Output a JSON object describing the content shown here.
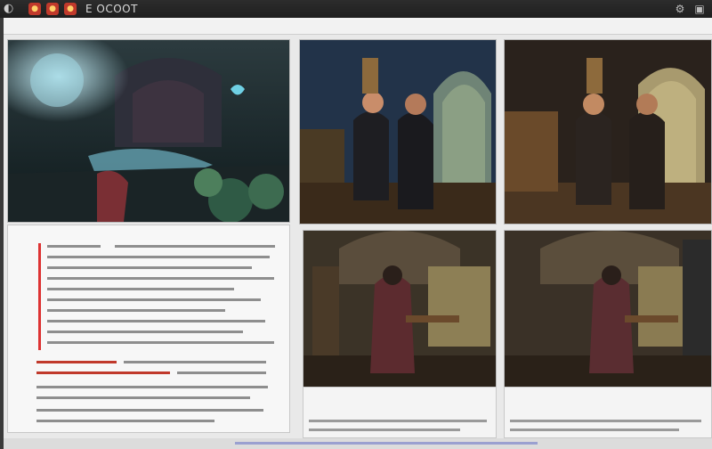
{
  "app": {
    "title": "E OCOOT"
  },
  "menubar": {
    "doc_line": ""
  },
  "panels": [
    {
      "name": "garden-scene"
    },
    {
      "name": "interior-scene-1"
    },
    {
      "name": "interior-scene-2"
    },
    {
      "name": "interior-scene-3"
    },
    {
      "name": "interior-scene-4"
    }
  ],
  "captions": [
    {
      "title": "",
      "subtitle": ""
    },
    {
      "title": "",
      "subtitle": ""
    }
  ],
  "colors": {
    "titlebar": "#1f1f1f",
    "accent_red": "#c0392b",
    "page": "#f7f7f7"
  },
  "icons": [
    "app-logo-icon",
    "close-icon",
    "minimize-icon",
    "maximize-icon",
    "settings-icon",
    "view-icon"
  ]
}
